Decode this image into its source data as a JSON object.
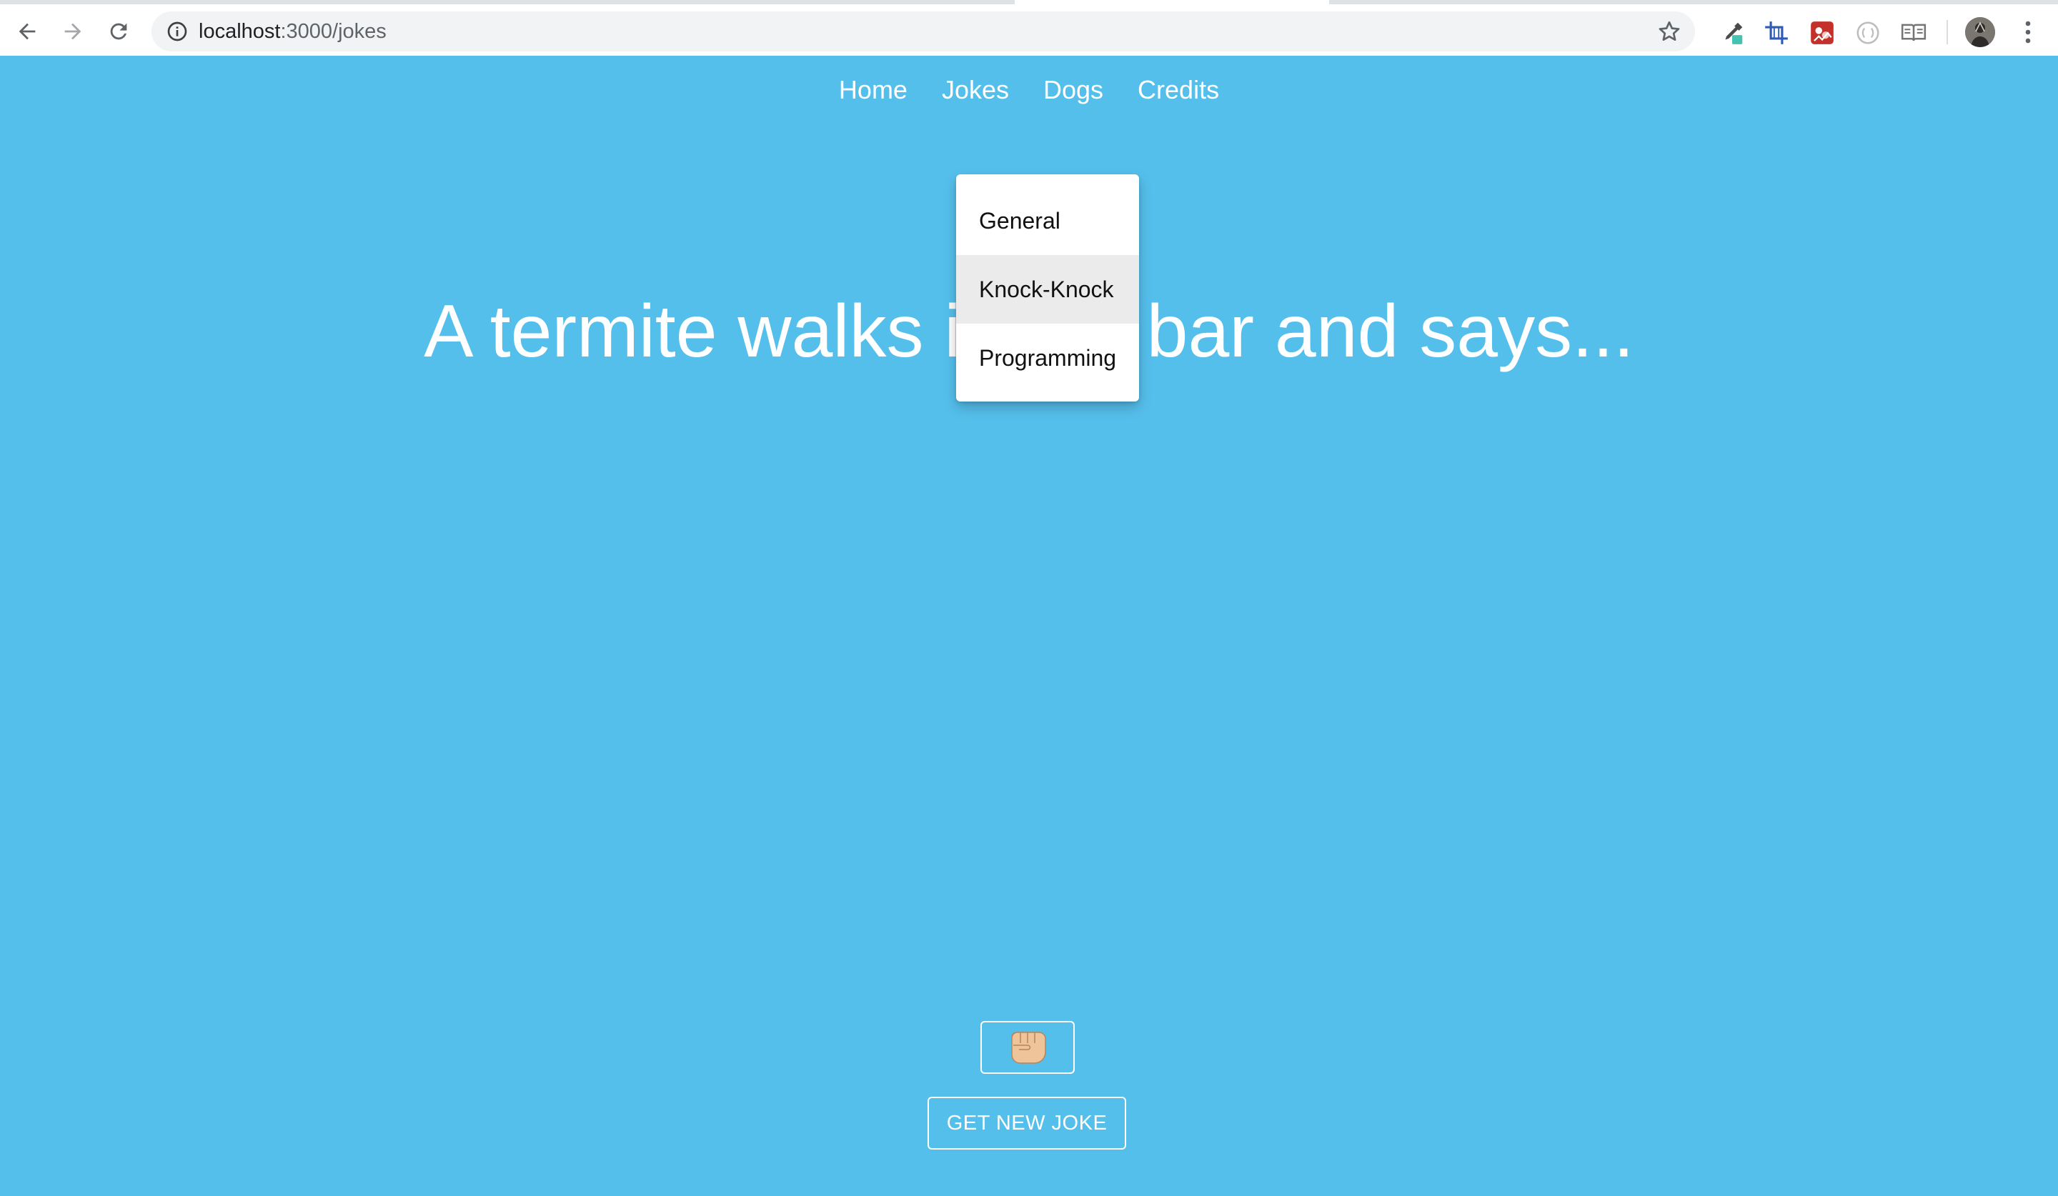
{
  "browser": {
    "url_host": "localhost",
    "url_rest": ":3000/jokes",
    "icons": {
      "back": "back-arrow-icon",
      "forward": "forward-arrow-icon",
      "reload": "reload-icon",
      "info": "info-icon",
      "bookmark": "star-icon",
      "extensions": [
        "eyedropper-icon",
        "crop-frame-icon",
        "red-extension-icon",
        "circle-extension-icon",
        "reader-icon"
      ],
      "profile": "avatar-icon",
      "menu": "more-vert-icon"
    }
  },
  "nav": {
    "items": [
      "Home",
      "Jokes",
      "Dogs",
      "Credits"
    ]
  },
  "joke": {
    "text": "A termite walks into a bar and says..."
  },
  "dropdown": {
    "items": [
      "General",
      "Knock-Knock",
      "Programming"
    ],
    "highlighted": "Knock-Knock"
  },
  "buttons": {
    "fist_icon": "fist-bump-icon",
    "new_joke": "GET NEW JOKE"
  },
  "colors": {
    "page_background": "#55bfec",
    "text": "#ffffff",
    "dropdown_highlight": "#ebebeb"
  }
}
